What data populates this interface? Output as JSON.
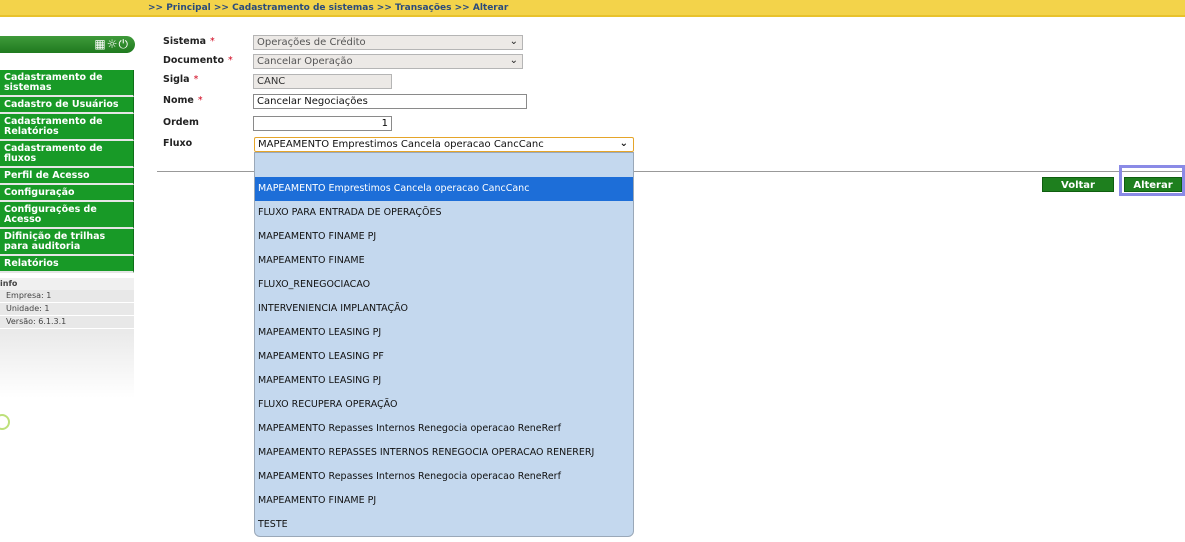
{
  "breadcrumb": {
    "text": ">> Principal >> Cadastramento de sistemas >> Transações >> Alterar"
  },
  "sidebar": {
    "header_icons": [
      "calculator-icon",
      "gear-icon",
      "power-icon"
    ],
    "header_glyphs": "▦☼⏻",
    "items": [
      {
        "label": "Cadastramento de sistemas"
      },
      {
        "label": "Cadastro de Usuários"
      },
      {
        "label": "Cadastramento de Relatórios"
      },
      {
        "label": "Cadastramento de fluxos"
      },
      {
        "label": "Perfil de Acesso"
      },
      {
        "label": "Configuração"
      },
      {
        "label": "Configurações de Acesso"
      },
      {
        "label": "Difinição de trilhas para auditoria"
      },
      {
        "label": "Relatórios"
      }
    ],
    "info": {
      "title": "info",
      "empresa": "Empresa: 1",
      "unidade": "Unidade: 1",
      "versao": "Versão: 6.1.3.1"
    }
  },
  "form": {
    "sistema": {
      "label": "Sistema",
      "value": "Operações de Crédito"
    },
    "documento": {
      "label": "Documento",
      "value": "Cancelar Operação"
    },
    "sigla": {
      "label": "Sigla",
      "value": "CANC"
    },
    "nome": {
      "label": "Nome",
      "value": "Cancelar Negociações"
    },
    "ordem": {
      "label": "Ordem",
      "value": "1"
    },
    "fluxo": {
      "label": "Fluxo",
      "value": "MAPEAMENTO Emprestimos Cancela operacao CancCanc"
    },
    "required_mark": "*"
  },
  "buttons": {
    "voltar": "Voltar",
    "alterar": "Alterar"
  },
  "dropdown": {
    "options": [
      "",
      "MAPEAMENTO Emprestimos Cancela operacao CancCanc",
      "FLUXO PARA ENTRADA DE OPERAÇÕES",
      "MAPEAMENTO FINAME PJ",
      "MAPEAMENTO FINAME",
      "FLUXO_RENEGOCIACAO",
      "INTERVENIENCIA IMPLANTAÇÃO",
      "MAPEAMENTO LEASING PJ",
      "MAPEAMENTO LEASING PF",
      "MAPEAMENTO LEASING PJ",
      "FLUXO RECUPERA OPERAÇÃO",
      "MAPEAMENTO Repasses Internos Renegocia operacao ReneRerf",
      "MAPEAMENTO REPASSES INTERNOS RENEGOCIA OPERACAO RENERERJ",
      "MAPEAMENTO Repasses Internos Renegocia operacao ReneRerf",
      "MAPEAMENTO FINAME PJ",
      "TESTE"
    ],
    "selected_index": 1
  },
  "colors": {
    "menu_green": "#189a27",
    "breadcrumb_yellow": "#f3d34a",
    "selected_option": "#1d6ed8",
    "dropdown_bg": "#c4d8ee"
  }
}
